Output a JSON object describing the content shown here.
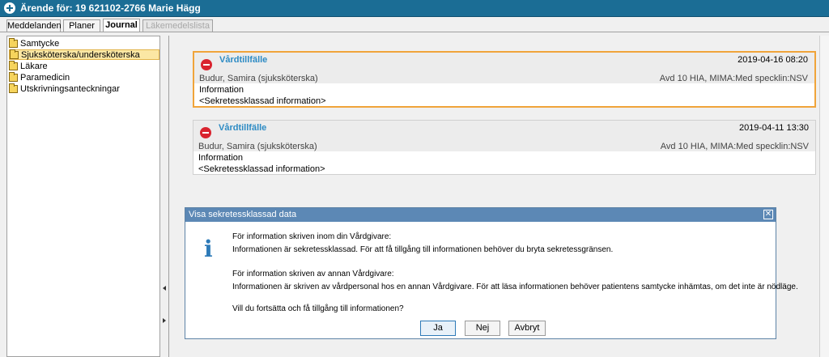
{
  "window": {
    "title": "Ärende för: 19 621102-2766 Marie Hägg"
  },
  "tabs": [
    {
      "label": "Meddelanden",
      "state": "normal"
    },
    {
      "label": "Planer",
      "state": "normal"
    },
    {
      "label": "Journal",
      "state": "active"
    },
    {
      "label": "Läkemedelslista",
      "state": "disabled"
    }
  ],
  "tree": {
    "items": [
      {
        "label": "Samtycke",
        "selected": false
      },
      {
        "label": "Sjuksköterska/undersköterska",
        "selected": true
      },
      {
        "label": "Läkare",
        "selected": false
      },
      {
        "label": "Paramedicin",
        "selected": false
      },
      {
        "label": "Utskrivningsanteckningar",
        "selected": false
      }
    ]
  },
  "entries": [
    {
      "title": "Vårdtillfälle",
      "date": "2019-04-16 08:20",
      "author": "Budur, Samira (sjuksköterska)",
      "unit": "Avd 10 HIA, MIMA:Med specklin:NSV",
      "heading": "Information",
      "body": "<Sekretessklassad information>"
    },
    {
      "title": "Vårdtillfälle",
      "date": "2019-04-11 13:30",
      "author": "Budur, Samira (sjuksköterska)",
      "unit": "Avd 10 HIA, MIMA:Med specklin:NSV",
      "heading": "Information",
      "body": "<Sekretessklassad information>"
    }
  ],
  "dialog": {
    "title": "Visa sekretessklassad data",
    "close_glyph": "✕",
    "info_glyph": "i",
    "lines": [
      "För information skriven inom din Vårdgivare:",
      "Informationen är sekretessklassad. För att få tillgång till informationen behöver du bryta sekretessgränsen.",
      "För information skriven av annan Vårdgivare:",
      "Informationen är skriven av vårdpersonal hos en annan Vårdgivare. För att läsa informationen behöver patientens samtycke inhämtas, om det inte är nödläge.",
      "Vill du fortsätta och få tillgång till informationen?"
    ],
    "buttons": {
      "yes": "Ja",
      "no": "Nej",
      "cancel": "Avbryt"
    }
  },
  "colors": {
    "titlebar": "#1b6d95",
    "entry_title": "#2d8bc4",
    "focus_border": "#f0a43a",
    "stop_icon": "#d9232e",
    "dialog_title": "#5c88b5"
  }
}
